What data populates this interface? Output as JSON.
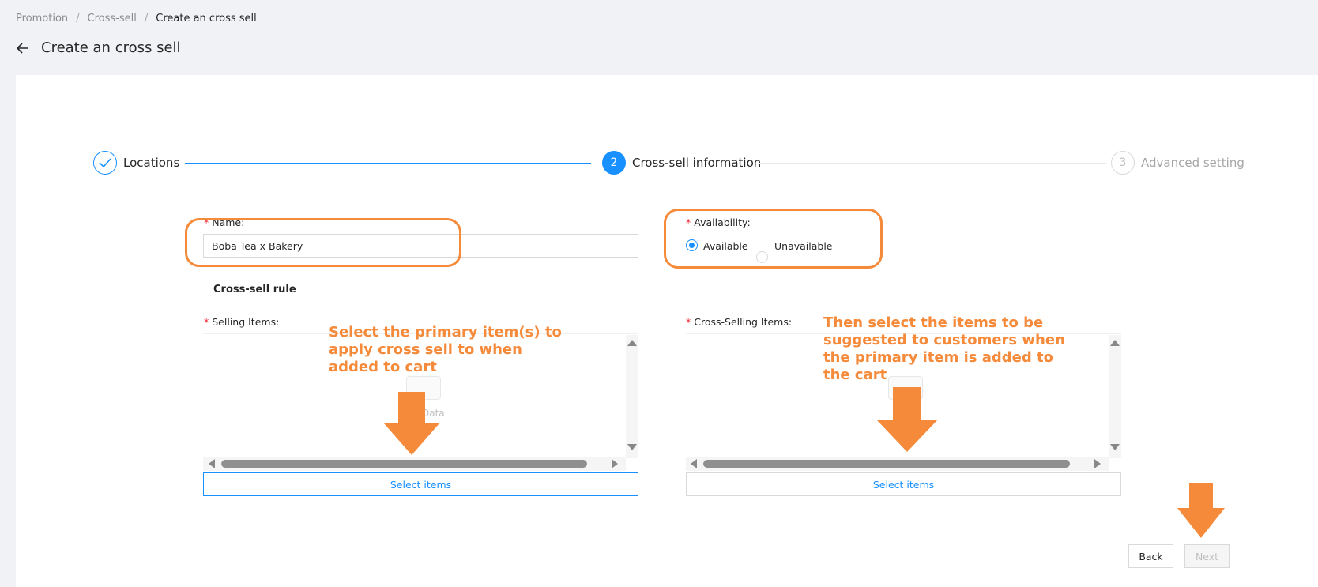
{
  "breadcrumb": {
    "items": [
      "Promotion",
      "Cross-sell"
    ],
    "current": "Create an cross sell",
    "separator": "/"
  },
  "page": {
    "title": "Create an cross sell"
  },
  "steps": [
    {
      "label": "Locations",
      "number": "",
      "status": "done"
    },
    {
      "label": "Cross-sell information",
      "number": "2",
      "status": "active"
    },
    {
      "label": "Advanced setting",
      "number": "3",
      "status": "wait"
    }
  ],
  "form": {
    "name": {
      "label": "Name:",
      "value": "Boba Tea x Bakery"
    },
    "availability": {
      "label": "Availability:",
      "options": [
        "Available",
        "Unavailable"
      ],
      "selected": "Available"
    },
    "rule_title": "Cross-sell rule",
    "selling": {
      "label": "Selling Items:",
      "empty_text": "Data",
      "button": "Select items"
    },
    "cross_selling": {
      "label": "Cross-Selling Items:",
      "button": "Select items"
    }
  },
  "annotations": {
    "left": "Select the primary item(s) to apply cross sell to when added to cart",
    "right": "Then select the items to be suggested to customers when the primary item is added to the cart"
  },
  "footer": {
    "back": "Back",
    "next": "Next"
  },
  "colors": {
    "primary": "#1890ff",
    "annotation": "#f58a3a",
    "required": "#f5222d"
  }
}
